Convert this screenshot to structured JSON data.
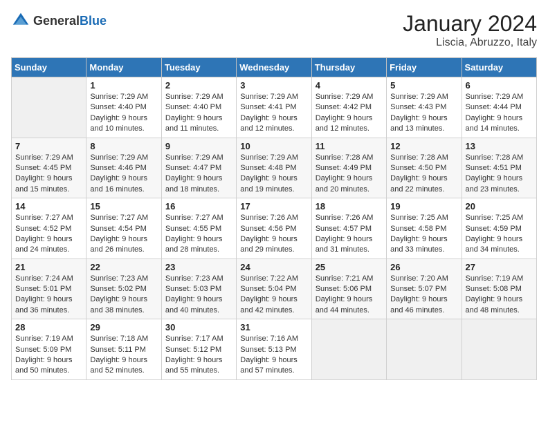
{
  "header": {
    "logo_general": "General",
    "logo_blue": "Blue",
    "title": "January 2024",
    "subtitle": "Liscia, Abruzzo, Italy"
  },
  "days_of_week": [
    "Sunday",
    "Monday",
    "Tuesday",
    "Wednesday",
    "Thursday",
    "Friday",
    "Saturday"
  ],
  "weeks": [
    [
      {
        "day": "",
        "sunrise": "",
        "sunset": "",
        "daylight": "",
        "empty": true
      },
      {
        "day": "1",
        "sunrise": "Sunrise: 7:29 AM",
        "sunset": "Sunset: 4:40 PM",
        "daylight": "Daylight: 9 hours and 10 minutes."
      },
      {
        "day": "2",
        "sunrise": "Sunrise: 7:29 AM",
        "sunset": "Sunset: 4:40 PM",
        "daylight": "Daylight: 9 hours and 11 minutes."
      },
      {
        "day": "3",
        "sunrise": "Sunrise: 7:29 AM",
        "sunset": "Sunset: 4:41 PM",
        "daylight": "Daylight: 9 hours and 12 minutes."
      },
      {
        "day": "4",
        "sunrise": "Sunrise: 7:29 AM",
        "sunset": "Sunset: 4:42 PM",
        "daylight": "Daylight: 9 hours and 12 minutes."
      },
      {
        "day": "5",
        "sunrise": "Sunrise: 7:29 AM",
        "sunset": "Sunset: 4:43 PM",
        "daylight": "Daylight: 9 hours and 13 minutes."
      },
      {
        "day": "6",
        "sunrise": "Sunrise: 7:29 AM",
        "sunset": "Sunset: 4:44 PM",
        "daylight": "Daylight: 9 hours and 14 minutes."
      }
    ],
    [
      {
        "day": "7",
        "sunrise": "Sunrise: 7:29 AM",
        "sunset": "Sunset: 4:45 PM",
        "daylight": "Daylight: 9 hours and 15 minutes."
      },
      {
        "day": "8",
        "sunrise": "Sunrise: 7:29 AM",
        "sunset": "Sunset: 4:46 PM",
        "daylight": "Daylight: 9 hours and 16 minutes."
      },
      {
        "day": "9",
        "sunrise": "Sunrise: 7:29 AM",
        "sunset": "Sunset: 4:47 PM",
        "daylight": "Daylight: 9 hours and 18 minutes."
      },
      {
        "day": "10",
        "sunrise": "Sunrise: 7:29 AM",
        "sunset": "Sunset: 4:48 PM",
        "daylight": "Daylight: 9 hours and 19 minutes."
      },
      {
        "day": "11",
        "sunrise": "Sunrise: 7:28 AM",
        "sunset": "Sunset: 4:49 PM",
        "daylight": "Daylight: 9 hours and 20 minutes."
      },
      {
        "day": "12",
        "sunrise": "Sunrise: 7:28 AM",
        "sunset": "Sunset: 4:50 PM",
        "daylight": "Daylight: 9 hours and 22 minutes."
      },
      {
        "day": "13",
        "sunrise": "Sunrise: 7:28 AM",
        "sunset": "Sunset: 4:51 PM",
        "daylight": "Daylight: 9 hours and 23 minutes."
      }
    ],
    [
      {
        "day": "14",
        "sunrise": "Sunrise: 7:27 AM",
        "sunset": "Sunset: 4:52 PM",
        "daylight": "Daylight: 9 hours and 24 minutes."
      },
      {
        "day": "15",
        "sunrise": "Sunrise: 7:27 AM",
        "sunset": "Sunset: 4:54 PM",
        "daylight": "Daylight: 9 hours and 26 minutes."
      },
      {
        "day": "16",
        "sunrise": "Sunrise: 7:27 AM",
        "sunset": "Sunset: 4:55 PM",
        "daylight": "Daylight: 9 hours and 28 minutes."
      },
      {
        "day": "17",
        "sunrise": "Sunrise: 7:26 AM",
        "sunset": "Sunset: 4:56 PM",
        "daylight": "Daylight: 9 hours and 29 minutes."
      },
      {
        "day": "18",
        "sunrise": "Sunrise: 7:26 AM",
        "sunset": "Sunset: 4:57 PM",
        "daylight": "Daylight: 9 hours and 31 minutes."
      },
      {
        "day": "19",
        "sunrise": "Sunrise: 7:25 AM",
        "sunset": "Sunset: 4:58 PM",
        "daylight": "Daylight: 9 hours and 33 minutes."
      },
      {
        "day": "20",
        "sunrise": "Sunrise: 7:25 AM",
        "sunset": "Sunset: 4:59 PM",
        "daylight": "Daylight: 9 hours and 34 minutes."
      }
    ],
    [
      {
        "day": "21",
        "sunrise": "Sunrise: 7:24 AM",
        "sunset": "Sunset: 5:01 PM",
        "daylight": "Daylight: 9 hours and 36 minutes."
      },
      {
        "day": "22",
        "sunrise": "Sunrise: 7:23 AM",
        "sunset": "Sunset: 5:02 PM",
        "daylight": "Daylight: 9 hours and 38 minutes."
      },
      {
        "day": "23",
        "sunrise": "Sunrise: 7:23 AM",
        "sunset": "Sunset: 5:03 PM",
        "daylight": "Daylight: 9 hours and 40 minutes."
      },
      {
        "day": "24",
        "sunrise": "Sunrise: 7:22 AM",
        "sunset": "Sunset: 5:04 PM",
        "daylight": "Daylight: 9 hours and 42 minutes."
      },
      {
        "day": "25",
        "sunrise": "Sunrise: 7:21 AM",
        "sunset": "Sunset: 5:06 PM",
        "daylight": "Daylight: 9 hours and 44 minutes."
      },
      {
        "day": "26",
        "sunrise": "Sunrise: 7:20 AM",
        "sunset": "Sunset: 5:07 PM",
        "daylight": "Daylight: 9 hours and 46 minutes."
      },
      {
        "day": "27",
        "sunrise": "Sunrise: 7:19 AM",
        "sunset": "Sunset: 5:08 PM",
        "daylight": "Daylight: 9 hours and 48 minutes."
      }
    ],
    [
      {
        "day": "28",
        "sunrise": "Sunrise: 7:19 AM",
        "sunset": "Sunset: 5:09 PM",
        "daylight": "Daylight: 9 hours and 50 minutes."
      },
      {
        "day": "29",
        "sunrise": "Sunrise: 7:18 AM",
        "sunset": "Sunset: 5:11 PM",
        "daylight": "Daylight: 9 hours and 52 minutes."
      },
      {
        "day": "30",
        "sunrise": "Sunrise: 7:17 AM",
        "sunset": "Sunset: 5:12 PM",
        "daylight": "Daylight: 9 hours and 55 minutes."
      },
      {
        "day": "31",
        "sunrise": "Sunrise: 7:16 AM",
        "sunset": "Sunset: 5:13 PM",
        "daylight": "Daylight: 9 hours and 57 minutes."
      },
      {
        "day": "",
        "sunrise": "",
        "sunset": "",
        "daylight": "",
        "empty": true
      },
      {
        "day": "",
        "sunrise": "",
        "sunset": "",
        "daylight": "",
        "empty": true
      },
      {
        "day": "",
        "sunrise": "",
        "sunset": "",
        "daylight": "",
        "empty": true
      }
    ]
  ]
}
